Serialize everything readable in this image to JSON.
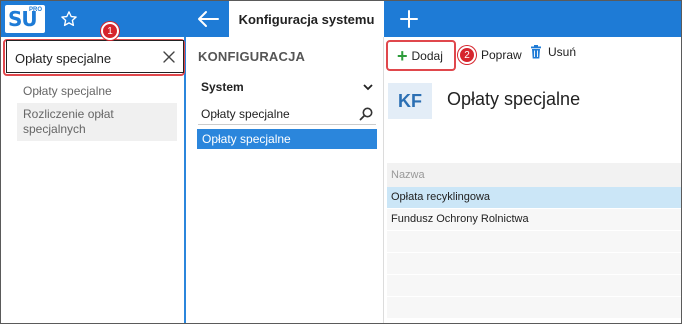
{
  "app": {
    "logo_text": "SU",
    "logo_sup": "PRO",
    "active_tab": "Konfiguracja systemu",
    "accent": "#1e7bd6",
    "icons": {
      "favorites": "star-icon",
      "back": "arrow-left-icon",
      "new_tab": "plus-icon"
    }
  },
  "search": {
    "value": "Opłaty specjalne",
    "results": [
      "Opłaty specjalne",
      "Rozliczenie opłat specjalnych"
    ]
  },
  "config_panel": {
    "header": "KONFIGURACJA",
    "group": "System",
    "filter_value": "Opłaty specjalne",
    "selected_item": "Opłaty specjalne"
  },
  "toolbar": {
    "add_label": "Dodaj",
    "edit_label": "Popraw",
    "delete_label": "Usuń"
  },
  "callouts": {
    "one": "1",
    "two": "2"
  },
  "detail": {
    "badge": "KF",
    "title": "Opłaty specjalne",
    "column_header": "Nazwa",
    "rows": [
      "Opłata recyklingowa",
      "Fundusz Ochrony Rolnictwa"
    ]
  }
}
